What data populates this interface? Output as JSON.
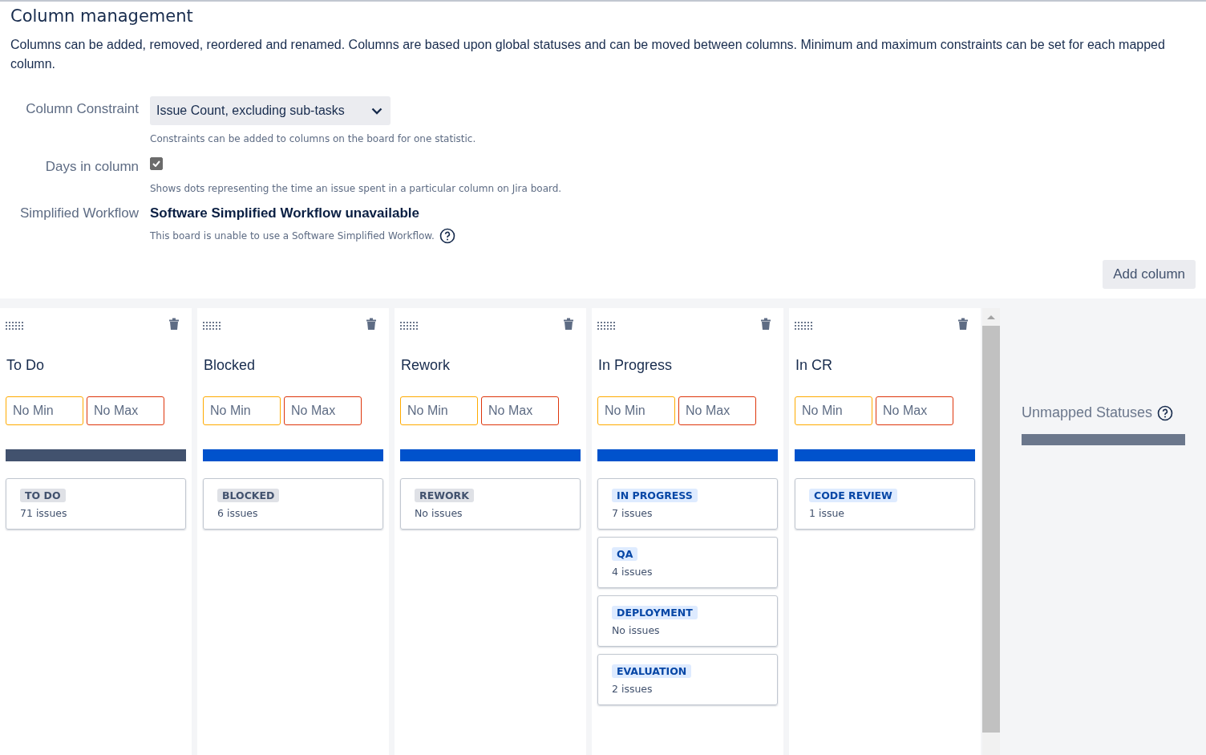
{
  "title": "Column management",
  "description": "Columns can be added, removed, reordered and renamed. Columns are based upon global statuses and can be moved between columns. Minimum and maximum constraints can be set for each mapped column.",
  "settings": {
    "column_constraint": {
      "label": "Column Constraint",
      "value": "Issue Count, excluding sub-tasks",
      "help": "Constraints can be added to columns on the board for one statistic."
    },
    "days_in_column": {
      "label": "Days in column",
      "checked": true,
      "help": "Shows dots representing the time an issue spent in a particular column on Jira board."
    },
    "simplified_workflow": {
      "label": "Simplified Workflow",
      "value": "Software Simplified Workflow unavailable",
      "help": "This board is unable to use a Software Simplified Workflow."
    }
  },
  "add_column_button": "Add column",
  "columns": [
    {
      "name": "To Do",
      "kind": "todo",
      "min_placeholder": "No Min",
      "max_placeholder": "No Max",
      "statuses": [
        {
          "name": "TO DO",
          "count": "71 issues"
        }
      ]
    },
    {
      "name": "Blocked",
      "kind": "inprogress",
      "min_placeholder": "No Min",
      "max_placeholder": "No Max",
      "statuses": [
        {
          "name": "BLOCKED",
          "count": "6 issues",
          "kind": "todo"
        }
      ]
    },
    {
      "name": "Rework",
      "kind": "inprogress",
      "min_placeholder": "No Min",
      "max_placeholder": "No Max",
      "statuses": [
        {
          "name": "REWORK",
          "count": "No issues",
          "kind": "todo"
        }
      ]
    },
    {
      "name": "In Progress",
      "kind": "inprogress",
      "min_placeholder": "No Min",
      "max_placeholder": "No Max",
      "statuses": [
        {
          "name": "IN PROGRESS",
          "count": "7 issues",
          "kind": "inprogress"
        },
        {
          "name": "QA",
          "count": "4 issues",
          "kind": "inprogress"
        },
        {
          "name": "DEPLOYMENT",
          "count": "No issues",
          "kind": "inprogress"
        },
        {
          "name": "EVALUATION",
          "count": "2 issues",
          "kind": "inprogress"
        }
      ]
    },
    {
      "name": "In CR",
      "kind": "inprogress",
      "min_placeholder": "No Min",
      "max_placeholder": "No Max",
      "statuses": [
        {
          "name": "CODE REVIEW",
          "count": "1 issue",
          "kind": "inprogress"
        }
      ]
    }
  ],
  "unmapped": {
    "title": "Unmapped Statuses"
  }
}
